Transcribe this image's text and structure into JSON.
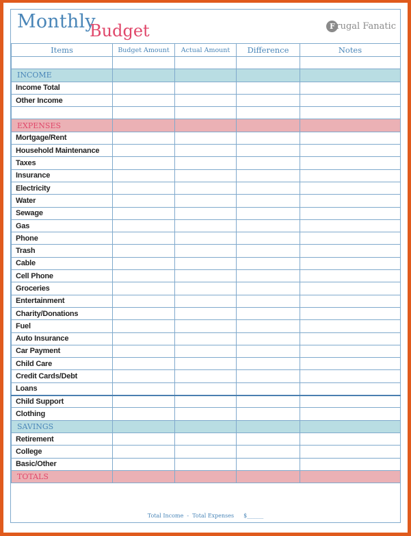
{
  "header": {
    "title_part1": "Monthly",
    "title_part2": "Budget",
    "brand_logo_letter": "F",
    "brand_name": "rugal Fanatic"
  },
  "columns": [
    "Items",
    "Budget Amount",
    "Actual Amount",
    "Difference",
    "Notes"
  ],
  "sections": {
    "income": {
      "label": "INCOME",
      "items": [
        "Income Total",
        "Other Income"
      ]
    },
    "expenses": {
      "label": "EXPENSES",
      "items": [
        "Mortgage/Rent",
        "Household Maintenance",
        "Taxes",
        "Insurance",
        "Electricity",
        "Water",
        "Sewage",
        "Gas",
        "Phone",
        "Trash",
        "Cable",
        "Cell Phone",
        "Groceries",
        "Entertainment",
        "Charity/Donations",
        "Fuel",
        "Auto Insurance",
        "Car Payment",
        "Child Care",
        "Credit Cards/Debt",
        "Loans",
        "Child Support",
        "Clothing"
      ]
    },
    "savings": {
      "label": "SAVINGS",
      "items": [
        "Retirement",
        "College",
        "Basic/Other"
      ]
    },
    "totals": {
      "label": "TOTALS"
    }
  },
  "footer": {
    "formula": "Total Income  -  Total Expenses",
    "blank": "$______"
  },
  "colors": {
    "border_orange": "#e05a1c",
    "grid_blue": "#7fa9cc",
    "title_blue": "#4a86b8",
    "title_pink": "#e0476a",
    "section_blue": "#b9dde3",
    "section_pink": "#ebb1b5"
  }
}
